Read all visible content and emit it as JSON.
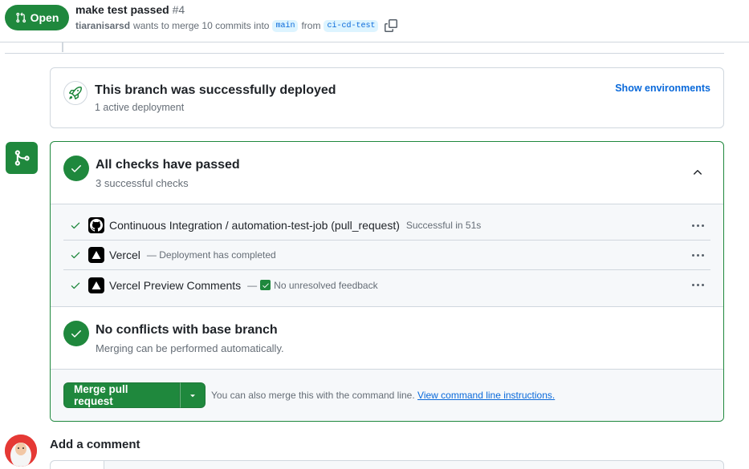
{
  "pr": {
    "state": "Open",
    "title": "make test passed",
    "number": "#4",
    "author": "tiaranisarsd",
    "meta_text": "wants to merge 10 commits into",
    "base_branch": "main",
    "from_text": "from",
    "head_branch": "ci-cd-test"
  },
  "deployment": {
    "title": "This branch was successfully deployed",
    "subtitle": "1 active deployment",
    "link": "Show environments"
  },
  "checks": {
    "title": "All checks have passed",
    "subtitle": "3 successful checks",
    "items": [
      {
        "name": "Continuous Integration / automation-test-job (pull_request)",
        "desc": "Successful in 51s",
        "icon": "github-icon"
      },
      {
        "name": "Vercel",
        "desc": "— Deployment has completed",
        "icon": "vercel-icon"
      },
      {
        "name": "Vercel Preview Comments",
        "desc_prefix": "—",
        "desc": "No unresolved feedback",
        "icon": "vercel-icon"
      }
    ]
  },
  "conflicts": {
    "title": "No conflicts with base branch",
    "subtitle": "Merging can be performed automatically."
  },
  "merge": {
    "button": "Merge pull request",
    "hint": "You can also merge this with the command line.",
    "hint_link": "View command line instructions."
  },
  "comment": {
    "title": "Add a comment"
  },
  "colors": {
    "success": "#1f883d",
    "link": "#0969da",
    "muted": "#656d76"
  }
}
